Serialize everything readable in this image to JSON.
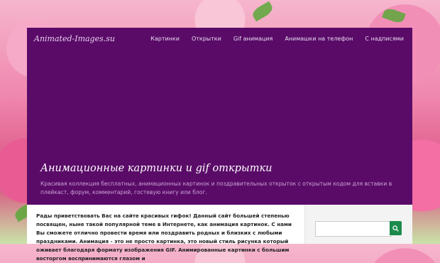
{
  "site": {
    "logo": "Animated-Images.su",
    "nav": [
      "Картинки",
      "Открытки",
      "Gif анимация",
      "Анимашки на телефон",
      "С надписями"
    ]
  },
  "hero": {
    "title": "Анимационные картинки и gif открытки",
    "description": "Красивая коллекция бесплатных, анимационных картинок и поздравительных открыток с открытым кодом для вставки в плейкаст, форум, комментарий, гостевую книгу или блог."
  },
  "content": {
    "intro": "Рады приветствовать Вас на сайте красивых гифок! Данный сайт большей степенью посвящен, ныне такой популярной теме в Интернете, как анимация картинок. С нами Вы сможете отлично провести время или поздравить родных и близких с любыми праздниками. Анимация - это не просто картинка, это новый стиль рисунка который оживает благодаря формату изображения GIF. Анимированные картинки с большим восторгом воспринимаются глазом и"
  },
  "sidebar": {
    "search_placeholder": "",
    "search_icon": "search-icon"
  },
  "colors": {
    "hero_bg": "#5a0b68",
    "search_button": "#1c8a4c"
  }
}
